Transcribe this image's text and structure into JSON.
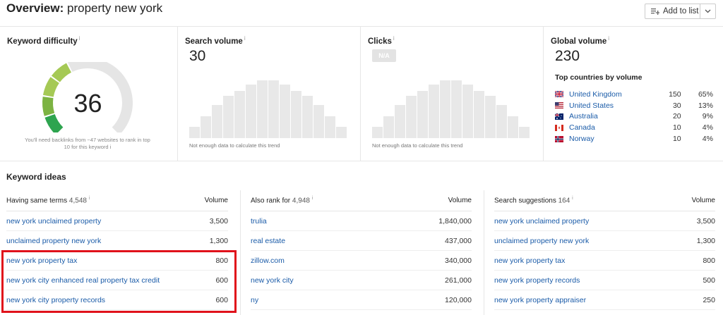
{
  "header": {
    "title_prefix": "Overview:",
    "query": "property new york",
    "add_to_list": "Add to list"
  },
  "keyword_difficulty": {
    "title": "Keyword difficulty",
    "info": "i",
    "value": "36",
    "score": 36,
    "note": "You'll need backlinks from ~47 websites to rank in top 10 for this keyword",
    "note_info": "i",
    "colors": {
      "low": "#2ea44f",
      "mid": "#7cb342",
      "light": "#a5c955",
      "empty": "#e5e5e5"
    }
  },
  "search_volume": {
    "title": "Search volume",
    "info": "i",
    "value": "30",
    "note": "Not enough data to calculate this trend"
  },
  "clicks": {
    "title": "Clicks",
    "info": "i",
    "value": "N/A",
    "note": "Not enough data to calculate this trend"
  },
  "global_volume": {
    "title": "Global volume",
    "info": "i",
    "value": "230",
    "top_title": "Top countries by volume",
    "countries": [
      {
        "name": "United Kingdom",
        "volume": "150",
        "pct": "65%",
        "flag": "gb"
      },
      {
        "name": "United States",
        "volume": "30",
        "pct": "13%",
        "flag": "us"
      },
      {
        "name": "Australia",
        "volume": "20",
        "pct": "9%",
        "flag": "au"
      },
      {
        "name": "Canada",
        "volume": "10",
        "pct": "4%",
        "flag": "ca"
      },
      {
        "name": "Norway",
        "volume": "10",
        "pct": "4%",
        "flag": "no"
      }
    ]
  },
  "keyword_ideas": {
    "title": "Keyword ideas",
    "columns": [
      {
        "label": "Having same terms",
        "count": "4,548",
        "info": "i",
        "vol_header": "Volume",
        "rows": [
          {
            "kw": "new york unclaimed property",
            "vol": "3,500"
          },
          {
            "kw": "unclaimed property new york",
            "vol": "1,300"
          },
          {
            "kw": "new york property tax",
            "vol": "800"
          },
          {
            "kw": "new york city enhanced real property tax credit",
            "vol": "600"
          },
          {
            "kw": "new york city property records",
            "vol": "600"
          }
        ]
      },
      {
        "label": "Also rank for",
        "count": "4,948",
        "info": "i",
        "vol_header": "Volume",
        "rows": [
          {
            "kw": "trulia",
            "vol": "1,840,000"
          },
          {
            "kw": "real estate",
            "vol": "437,000"
          },
          {
            "kw": "zillow.com",
            "vol": "340,000"
          },
          {
            "kw": "new york city",
            "vol": "261,000"
          },
          {
            "kw": "ny",
            "vol": "120,000"
          }
        ]
      },
      {
        "label": "Search suggestions",
        "count": "164",
        "info": "i",
        "vol_header": "Volume",
        "rows": [
          {
            "kw": "new york unclaimed property",
            "vol": "3,500"
          },
          {
            "kw": "unclaimed property new york",
            "vol": "1,300"
          },
          {
            "kw": "new york property tax",
            "vol": "800"
          },
          {
            "kw": "new york property records",
            "vol": "500"
          },
          {
            "kw": "new york property appraiser",
            "vol": "250"
          }
        ]
      }
    ]
  }
}
